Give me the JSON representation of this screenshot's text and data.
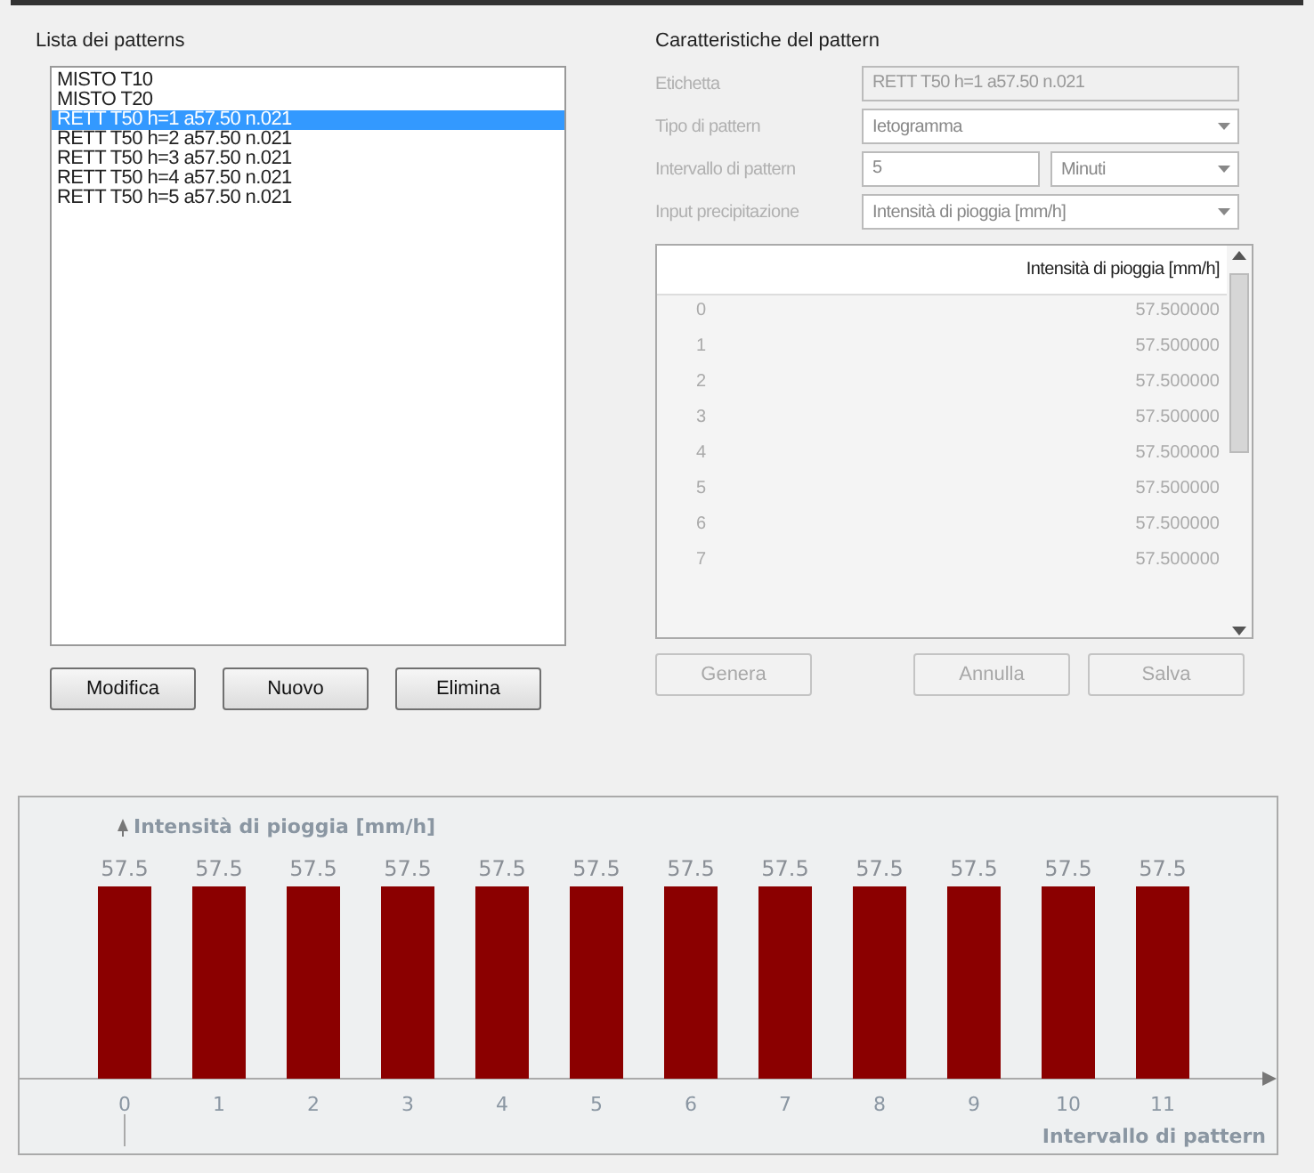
{
  "patterns_group": {
    "title": "Lista dei patterns",
    "items": [
      {
        "label": "MISTO T10",
        "selected": false
      },
      {
        "label": "MISTO T20",
        "selected": false
      },
      {
        "label": "RETT T50 h=1 a57.50 n.021",
        "selected": true
      },
      {
        "label": "RETT T50 h=2 a57.50 n.021",
        "selected": false
      },
      {
        "label": "RETT T50 h=3 a57.50 n.021",
        "selected": false
      },
      {
        "label": "RETT T50 h=4 a57.50 n.021",
        "selected": false
      },
      {
        "label": "RETT T50 h=5 a57.50 n.021",
        "selected": false
      }
    ],
    "buttons": [
      {
        "label": "Modifica",
        "disabled": false
      },
      {
        "label": "Nuovo",
        "disabled": false
      },
      {
        "label": "Elimina",
        "disabled": false
      }
    ]
  },
  "properties_group": {
    "title": "Caratteristiche del pattern",
    "fields": [
      {
        "label": "Etichetta",
        "kind": "text",
        "value": "RETT T50 h=1 a57.50 n.021",
        "disabled": true
      },
      {
        "label": "Tipo di pattern",
        "kind": "dropdown",
        "value": "Ietogramma",
        "disabled": true
      },
      {
        "label": "Intervallo di pattern",
        "kind": "number_unit",
        "value": "5",
        "unit": "Minuti",
        "disabled": true
      },
      {
        "label": "Input precipitazione",
        "kind": "dropdown",
        "value": "Intensità di pioggia [mm/h]",
        "disabled": true
      }
    ],
    "table": {
      "columns": [
        "Intensità di pioggia [mm/h]"
      ],
      "rows": [
        {
          "index": "0",
          "value": "57.500000"
        },
        {
          "index": "1",
          "value": "57.500000"
        },
        {
          "index": "2",
          "value": "57.500000"
        },
        {
          "index": "3",
          "value": "57.500000"
        },
        {
          "index": "4",
          "value": "57.500000"
        },
        {
          "index": "5",
          "value": "57.500000"
        },
        {
          "index": "6",
          "value": "57.500000"
        },
        {
          "index": "7",
          "value": "57.500000"
        }
      ]
    },
    "buttons": [
      {
        "label": "Genera",
        "disabled": true
      },
      {
        "label": "Annulla",
        "disabled": true
      },
      {
        "label": "Salva",
        "disabled": true
      }
    ]
  },
  "chart": {
    "chart_data": {
      "type": "bar",
      "ylabel": "Intensità di pioggia [mm/h]",
      "xlabel": "Intervallo di pattern",
      "categories": [
        "0",
        "1",
        "2",
        "3",
        "4",
        "5",
        "6",
        "7",
        "8",
        "9",
        "10",
        "11"
      ],
      "values": [
        57.5,
        57.5,
        57.5,
        57.5,
        57.5,
        57.5,
        57.5,
        57.5,
        57.5,
        57.5,
        57.5,
        57.5
      ],
      "data_labels": true
    }
  }
}
